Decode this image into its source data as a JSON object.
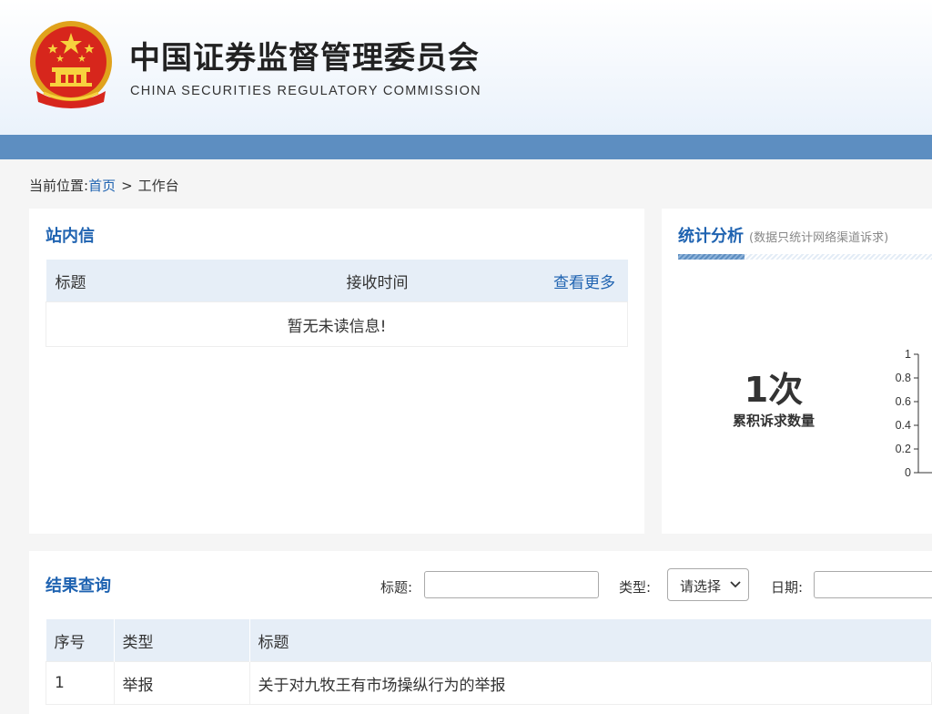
{
  "header": {
    "title": "中国证券监督管理委员会",
    "subtitle": "CHINA SECURITIES REGULATORY COMMISSION",
    "emblem_icon": "national-emblem-icon"
  },
  "colors": {
    "brand_blue": "#1f63b1",
    "navbar": "#5d8ec1",
    "table_header_bg": "#e6eef7"
  },
  "breadcrumb": {
    "prefix": "当前位置:",
    "home": "首页",
    "separator": ">",
    "current": "工作台"
  },
  "mail": {
    "title": "站内信",
    "columns": [
      "标题",
      "接收时间"
    ],
    "more_link": "查看更多",
    "empty_message": "暂无未读信息!"
  },
  "stats": {
    "title": "统计分析",
    "note": "(数据只统计网络渠道诉求)",
    "total_value": "1次",
    "total_label": "累积诉求数量",
    "y_ticks": [
      "1",
      "0.8",
      "0.6",
      "0.4",
      "0.2",
      "0"
    ]
  },
  "query": {
    "title": "结果查询",
    "title_label": "标题:",
    "title_value": "",
    "type_label": "类型:",
    "type_selected": "请选择",
    "date_label": "日期:",
    "date_value": "",
    "columns": [
      "序号",
      "类型",
      "标题"
    ],
    "rows": [
      {
        "index": "1",
        "type": "举报",
        "title": "关于对九牧王有市场操纵行为的举报"
      }
    ]
  }
}
